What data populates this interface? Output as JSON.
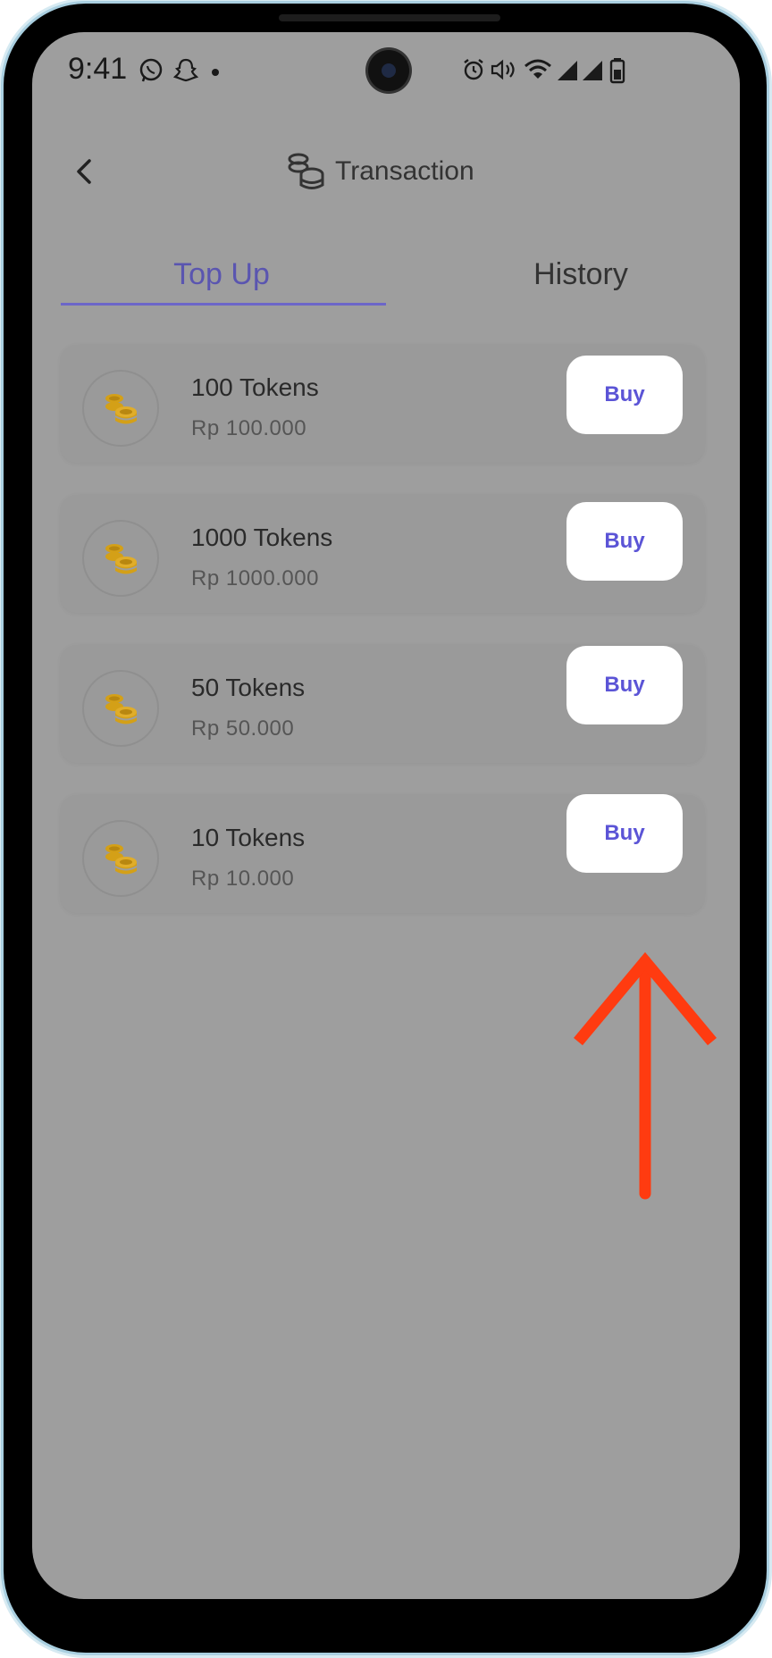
{
  "status_bar": {
    "time": "9:41",
    "left_icons": [
      "whatsapp-icon",
      "snapchat-icon",
      "notification-dot-icon"
    ],
    "right_icons": [
      "alarm-icon",
      "volume-icon",
      "wifi-icon",
      "signal-icon",
      "signal-icon",
      "battery-icon"
    ]
  },
  "header": {
    "back_icon": "chevron-left-icon",
    "title_icon": "coins-stack-icon",
    "title": "Transaction"
  },
  "tabs": [
    {
      "label": "Top Up",
      "active": true
    },
    {
      "label": "History",
      "active": false
    }
  ],
  "packages": [
    {
      "name": "100 Tokens",
      "price": "Rp 100.000",
      "button": "Buy"
    },
    {
      "name": "1000 Tokens",
      "price": "Rp 1000.000",
      "button": "Buy"
    },
    {
      "name": "50 Tokens",
      "price": "Rp 50.000",
      "button": "Buy"
    },
    {
      "name": "10 Tokens",
      "price": "Rp 10.000",
      "button": "Buy"
    }
  ],
  "colors": {
    "accent": "#6c66c8",
    "buy_text": "#5b54d6",
    "coin": "#d4a017",
    "annotation_arrow": "#ff3b10",
    "overlay": "#9e9e9e"
  }
}
